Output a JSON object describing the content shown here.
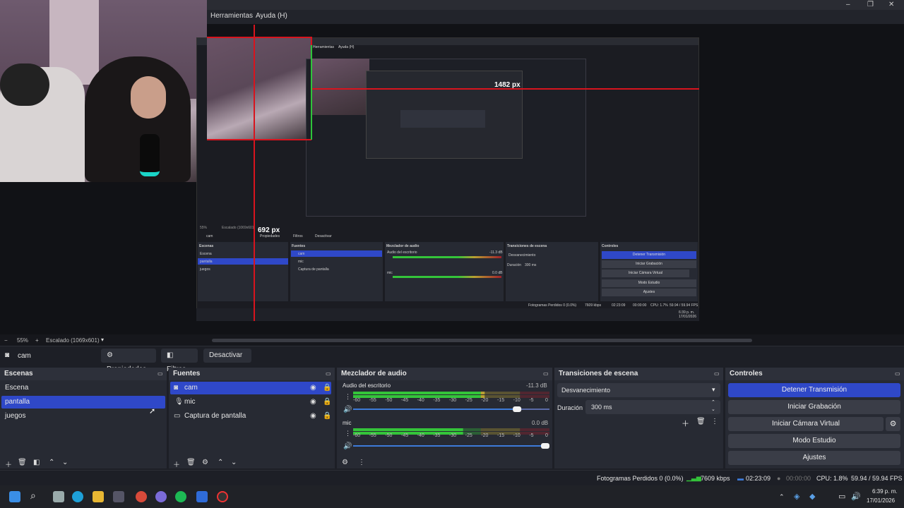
{
  "window": {
    "controls": [
      "–",
      "❐",
      "✕"
    ]
  },
  "menubar": {
    "tools": "Herramientas",
    "help": "Ayuda (H)"
  },
  "preview": {
    "measure_h": "1482 px",
    "measure_v": "692 px",
    "nested_menu_tools": "Herramientas",
    "nested_menu_help": "Ayuda (H)",
    "nested": {
      "source": "cam",
      "props": "Propiedades",
      "filters": "Filtros",
      "deactivate": "Desactivar",
      "zoom": "55%",
      "scaled": "Escalado (1069x601)",
      "scenes_title": "Escenas",
      "scenes": [
        "Escena",
        "pantalla",
        "juegos"
      ],
      "sources_title": "Fuentes",
      "sources": [
        "cam",
        "mic",
        "Captura de pantalla"
      ],
      "mixer_title": "Mezclador de audio",
      "desktop_audio": "Audio del escritorio",
      "desktop_db": "-11.3 dB",
      "mic": "mic",
      "mic_db": "0.0 dB",
      "transitions_title": "Transiciones de escena",
      "transition": "Desvanecimiento",
      "duration_label": "Duración",
      "duration": "300 ms",
      "controls_title": "Controles",
      "controls": [
        "Detener Transmisión",
        "Iniciar Grabación",
        "Iniciar Cámara Virtual",
        "Modo Estudio",
        "Ajustes"
      ],
      "status": "Fotogramas Perdidos 0 (0.0%)",
      "kbps": "7609 kbps",
      "time": "02:23:09",
      "rec": "00:00:00",
      "cpu": "CPU: 1.7%",
      "fps": "59.94 / 59.94 FPS",
      "clock": "6:39 p. m.",
      "date": "17/01/2026"
    }
  },
  "preview_bar": {
    "zoom": "55%",
    "scaled": "Escalado (1069x601)"
  },
  "source_toolbar": {
    "source_name": "cam",
    "properties": "Propiedades",
    "filters": "Filtros",
    "deactivate": "Desactivar"
  },
  "scenes": {
    "title": "Escenas",
    "items": [
      "Escena",
      "pantalla",
      "juegos"
    ],
    "selected": 1
  },
  "sources": {
    "title": "Fuentes",
    "items": [
      {
        "name": "cam",
        "icon": "camera-icon"
      },
      {
        "name": "mic",
        "icon": "microphone-icon"
      },
      {
        "name": "Captura de pantalla",
        "icon": "monitor-icon"
      }
    ]
  },
  "mixer": {
    "title": "Mezclador de audio",
    "tracks": [
      {
        "name": "Audio del escritorio",
        "db": "-11.3 dB",
        "level": 0.67,
        "volume": 0.85
      },
      {
        "name": "mic",
        "db": "0.0 dB",
        "level": 0.56,
        "volume": 1.0
      }
    ],
    "scale": [
      "-60",
      "-55",
      "-50",
      "-45",
      "-40",
      "-35",
      "-30",
      "-25",
      "-20",
      "-15",
      "-10",
      "-5",
      "0"
    ]
  },
  "transitions": {
    "title": "Transiciones de escena",
    "type": "Desvanecimiento",
    "duration_label": "Duración",
    "duration": "300 ms"
  },
  "controls": {
    "title": "Controles",
    "stop_stream": "Detener Transmisión",
    "start_recording": "Iniciar Grabación",
    "start_virtual_cam": "Iniciar Cámara Virtual",
    "studio_mode": "Modo Estudio",
    "settings": "Ajustes"
  },
  "status": {
    "dropped": "Fotogramas Perdidos 0 (0.0%)",
    "kbps": "7609 kbps",
    "stream_time": "02:23:09",
    "rec_time": "00:00:00",
    "cpu": "CPU: 1.8%",
    "fps": "59.94 / 59.94 FPS"
  },
  "taskbar": {
    "clock": "6:39 p. m.",
    "date": "17/01/2026"
  },
  "colors": {
    "accent": "#2f48c8",
    "redline": "#d8141e",
    "meter_green": "#34c43a",
    "meter_yellow": "#b8a032",
    "meter_red": "#a0202a"
  }
}
